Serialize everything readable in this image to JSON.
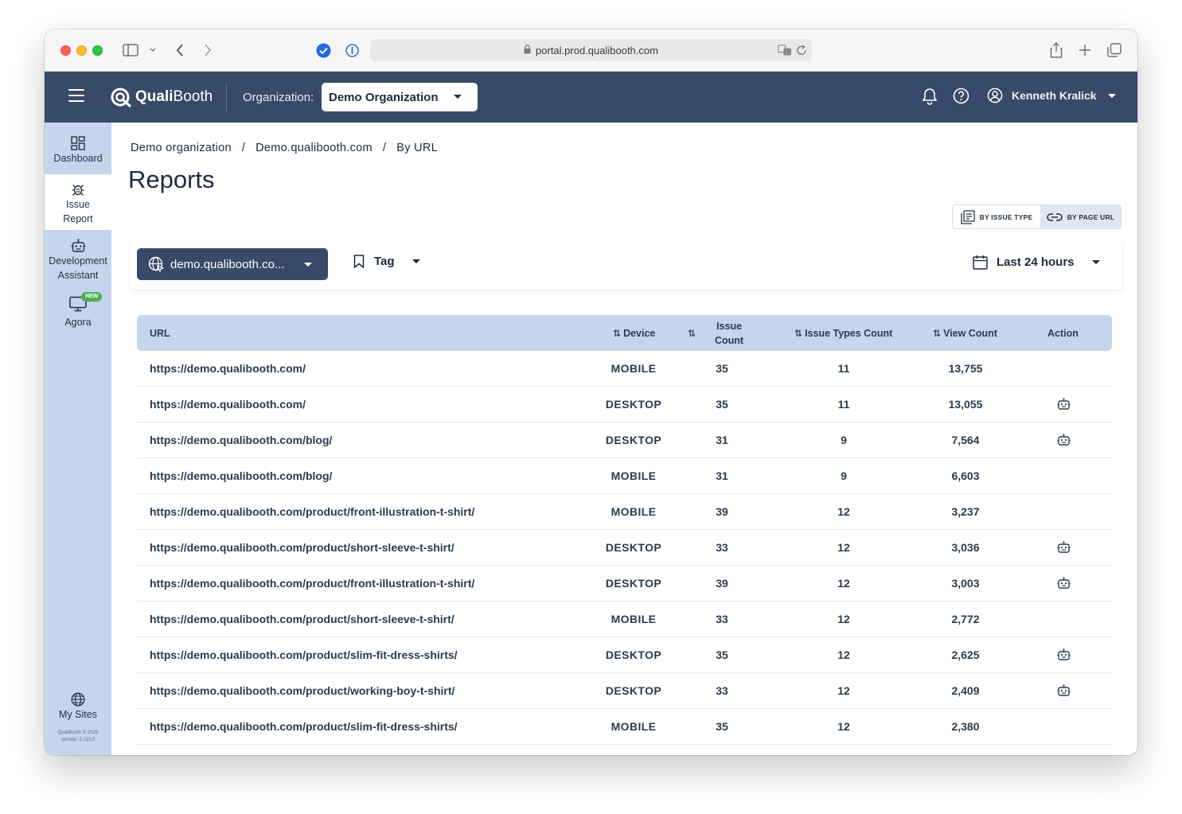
{
  "browser": {
    "url": "portal.prod.qualibooth.com"
  },
  "header": {
    "logo_bold": "Quali",
    "logo_thin": "Booth",
    "org_label": "Organization:",
    "org_value": "Demo Organization",
    "user_name": "Kenneth Kralick"
  },
  "sidebar": {
    "items": [
      {
        "label": "Dashboard",
        "icon": "dashboard-icon"
      },
      {
        "label": "Issue Report",
        "icon": "bug-icon"
      },
      {
        "label": "Development Assistant",
        "icon": "robot-icon"
      },
      {
        "label": "Agora",
        "icon": "monitor-icon",
        "badge": "NEW"
      }
    ],
    "bottom_label": "My Sites",
    "copyright_line1": "QualiBooth © 2025",
    "copyright_line2": "version: 2.113.0"
  },
  "breadcrumb": [
    "Demo organization",
    "Demo.qualibooth.com",
    "By URL"
  ],
  "page_title": "Reports",
  "view_toggle": {
    "by_issue_type": "BY ISSUE TYPE",
    "by_page_url": "BY PAGE URL"
  },
  "filters": {
    "site": "demo.qualibooth.co...",
    "tag": "Tag",
    "date_range": "Last 24 hours"
  },
  "table": {
    "columns": {
      "url": "URL",
      "device": "Device",
      "issue_count_1": "Issue",
      "issue_count_2": "Count",
      "issue_types": "Issue Types Count",
      "view_count": "View Count",
      "action": "Action"
    },
    "rows": [
      {
        "url": "https://demo.qualibooth.com/",
        "device": "MOBILE",
        "issues": "35",
        "types": "11",
        "views": "13,755",
        "action": false
      },
      {
        "url": "https://demo.qualibooth.com/",
        "device": "DESKTOP",
        "issues": "35",
        "types": "11",
        "views": "13,055",
        "action": true
      },
      {
        "url": "https://demo.qualibooth.com/blog/",
        "device": "DESKTOP",
        "issues": "31",
        "types": "9",
        "views": "7,564",
        "action": true
      },
      {
        "url": "https://demo.qualibooth.com/blog/",
        "device": "MOBILE",
        "issues": "31",
        "types": "9",
        "views": "6,603",
        "action": false
      },
      {
        "url": "https://demo.qualibooth.com/product/front-illustration-t-shirt/",
        "device": "MOBILE",
        "issues": "39",
        "types": "12",
        "views": "3,237",
        "action": false
      },
      {
        "url": "https://demo.qualibooth.com/product/short-sleeve-t-shirt/",
        "device": "DESKTOP",
        "issues": "33",
        "types": "12",
        "views": "3,036",
        "action": true
      },
      {
        "url": "https://demo.qualibooth.com/product/front-illustration-t-shirt/",
        "device": "DESKTOP",
        "issues": "39",
        "types": "12",
        "views": "3,003",
        "action": true
      },
      {
        "url": "https://demo.qualibooth.com/product/short-sleeve-t-shirt/",
        "device": "MOBILE",
        "issues": "33",
        "types": "12",
        "views": "2,772",
        "action": false
      },
      {
        "url": "https://demo.qualibooth.com/product/slim-fit-dress-shirts/",
        "device": "DESKTOP",
        "issues": "35",
        "types": "12",
        "views": "2,625",
        "action": true
      },
      {
        "url": "https://demo.qualibooth.com/product/working-boy-t-shirt/",
        "device": "DESKTOP",
        "issues": "33",
        "types": "12",
        "views": "2,409",
        "action": true
      },
      {
        "url": "https://demo.qualibooth.com/product/slim-fit-dress-shirts/",
        "device": "MOBILE",
        "issues": "35",
        "types": "12",
        "views": "2,380",
        "action": false
      }
    ]
  },
  "colors": {
    "header_bg": "#374a67",
    "sidebar_bg": "#c5d5ed",
    "table_header_bg": "#c5d5ed",
    "badge_green": "#4caf50"
  }
}
